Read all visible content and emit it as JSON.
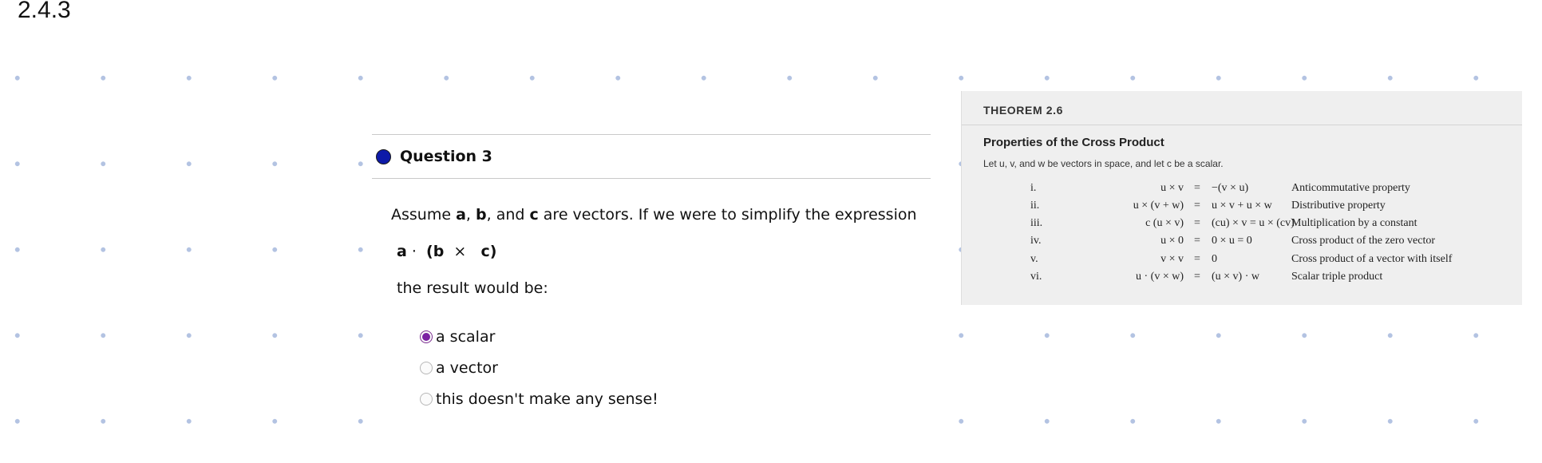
{
  "slide": {
    "number": "2.4.3"
  },
  "question": {
    "title": "Question 3",
    "prompt": {
      "pre": "Assume ",
      "a": "a",
      "sep1": ", ",
      "b": "b",
      "sep2": ", and ",
      "c": "c",
      "post": " are vectors. If we were to simplify the expression"
    },
    "expression": {
      "a": "a",
      "dot": " · ",
      "open": "(",
      "b": "b",
      "cross": " × ",
      "c": "c",
      "close": ")"
    },
    "result_text": "the result would be:",
    "options": [
      {
        "label": "a scalar",
        "selected": true
      },
      {
        "label": "a vector",
        "selected": false
      },
      {
        "label": "this doesn't make any sense!",
        "selected": false
      }
    ]
  },
  "theorem": {
    "label": "THEOREM 2.6",
    "title": "Properties of the Cross Product",
    "intro": "Let u, v, and w be vectors in space, and let c be a scalar.",
    "rows": [
      {
        "num": "i.",
        "lhs": "u × v",
        "eq": "=",
        "rhs": "−(v × u)",
        "desc": "Anticommutative property"
      },
      {
        "num": "ii.",
        "lhs": "u × (v + w)",
        "eq": "=",
        "rhs": "u × v + u × w",
        "desc": "Distributive property"
      },
      {
        "num": "iii.",
        "lhs": "c (u × v)",
        "eq": "=",
        "rhs": "(cu) × v = u × (cv)",
        "desc": "Multiplication by a constant"
      },
      {
        "num": "iv.",
        "lhs": "u × 0",
        "eq": "=",
        "rhs": "0 × u = 0",
        "desc": "Cross product of the zero vector"
      },
      {
        "num": "v.",
        "lhs": "v × v",
        "eq": "=",
        "rhs": "0",
        "desc": "Cross product of a vector with itself"
      },
      {
        "num": "vi.",
        "lhs": "u · (v × w)",
        "eq": "=",
        "rhs": "(u × v) · w",
        "desc": "Scalar triple product"
      }
    ]
  },
  "colors": {
    "question_dot": "#0d1aa8",
    "radio_selected": "#7b1fa2",
    "grid_dots": "#b3c3e2",
    "theorem_bg": "#efefef"
  }
}
